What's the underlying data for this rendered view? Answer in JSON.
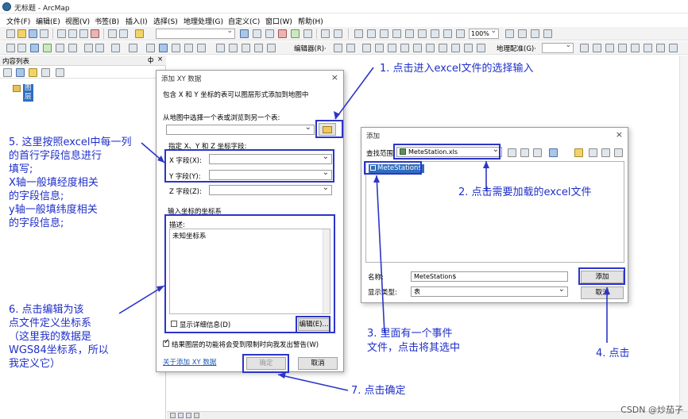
{
  "window": {
    "title": "无标题 - ArcMap"
  },
  "menu": [
    "文件(F)",
    "编辑(E)",
    "视图(V)",
    "书签(B)",
    "插入(I)",
    "选择(S)",
    "地理处理(G)",
    "自定义(C)",
    "窗口(W)",
    "帮助(H)"
  ],
  "toolbar": {
    "zoom_value": "100%",
    "editor_label": "编辑器(R)·",
    "geoproc_label": "地理配准(G)·"
  },
  "toc": {
    "title": "内容列表",
    "pin": "ф",
    "close": "×",
    "layer_label": "图层"
  },
  "xy_dialog": {
    "title": "添加 XY 数据",
    "close": "×",
    "description": "包含 X 和 Y 坐标的表可以图层形式添加到地图中",
    "choose_table_label": "从地图中选择一个表或浏览到另一个表:",
    "fields_group_label": "指定 X、Y 和 Z 坐标字段:",
    "x_label": "X 字段(X):",
    "y_label": "Y 字段(Y):",
    "z_label": "Z 字段(Z):",
    "coord_group_label": "输入坐标的坐标系",
    "desc_label": "描述:",
    "coord_value": "未知坐标系",
    "show_details_label": "显示详细信息(D)",
    "edit_button": "编辑(E)...",
    "warn_checkbox_label": "结果图层的功能将会受到限制时向我发出警告(W)",
    "about_link": "关于添加 XY 数据",
    "ok_button": "确定",
    "cancel_button": "取消"
  },
  "add_dialog": {
    "title": "添加",
    "close": "×",
    "lookin_label": "查找范围:",
    "lookin_value": "MeteStation.xls",
    "item": "MeteStation$",
    "name_label": "名称:",
    "name_value": "MeteStation$",
    "type_label": "显示类型:",
    "type_value": "表",
    "add_button": "添加",
    "cancel_button": "取消"
  },
  "annotations": {
    "a1": "1. 点击进入excel文件的选择输入",
    "a2": "2. 点击需要加载的excel文件",
    "a3_line1": "3. 里面有一个事件",
    "a3_line2": "文件，点击将其选中",
    "a4": "4. 点击",
    "a5_line1": "5. 这里按照excel中每一列",
    "a5_line2": "的首行字段信息进行",
    "a5_line3": "填写;",
    "a5_line4": "X轴一般填经度相关",
    "a5_line5": "的字段信息;",
    "a5_line6": "y轴一般填纬度相关",
    "a5_line7": "的字段信息;",
    "a6_line1": "6. 点击编辑为该",
    "a6_line2": "点文件定义坐标系",
    "a6_line3": "（这里我的数据是",
    "a6_line4": "WGS84坐标系，所以",
    "a6_line5": "我定义它）",
    "a7": "7. 点击确定"
  },
  "watermark": "CSDN @炒茄子",
  "colors": {
    "annotation": "#1f2fc9",
    "selection": "#2f6dbf"
  }
}
